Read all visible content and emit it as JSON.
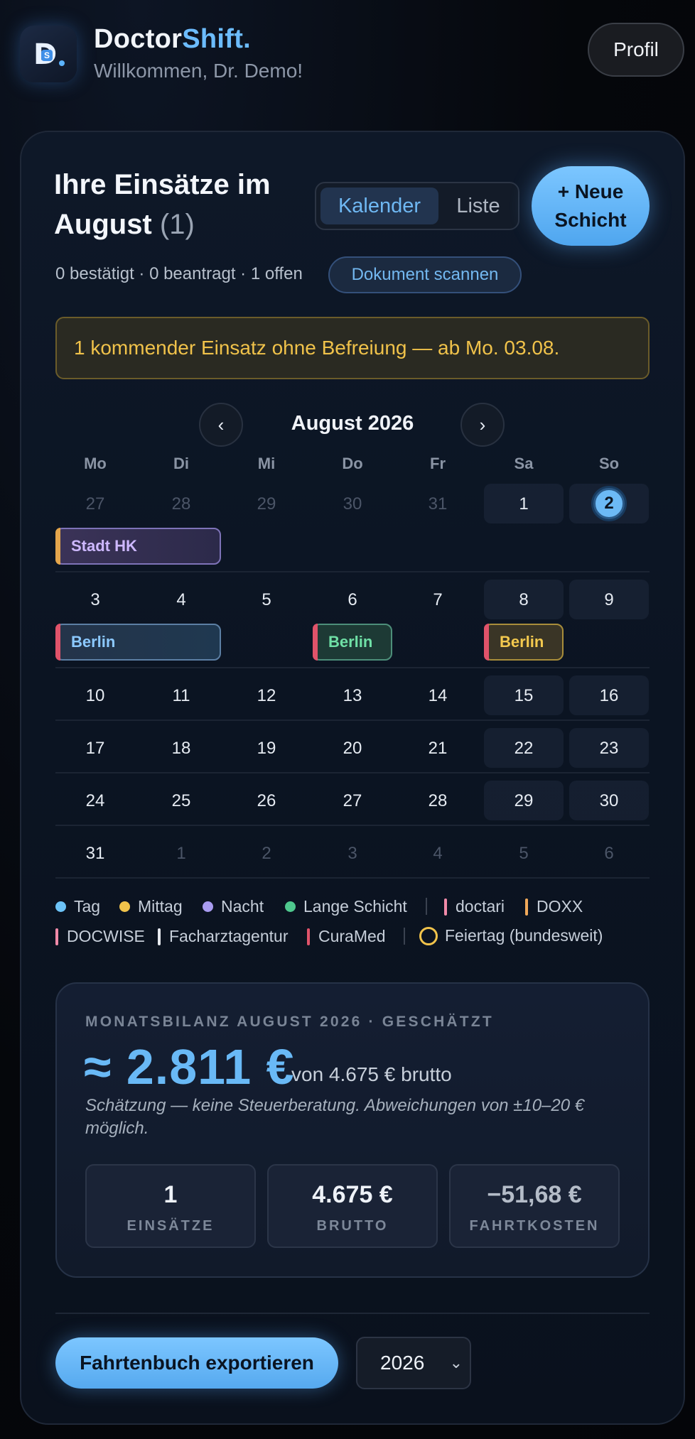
{
  "header": {
    "brand_part1": "Doctor",
    "brand_part2": "Shift.",
    "welcome": "Willkommen, Dr. Demo!",
    "profile_label": "Profil",
    "logo_letter": "D",
    "logo_inner": "S"
  },
  "overview": {
    "title": "Ihre Einsätze im August",
    "count": "(1)",
    "view_calendar": "Kalender",
    "view_list": "Liste",
    "new_shift": "+ Neue\nSchicht",
    "stats": "0 bestätigt · 0 beantragt · 1 offen",
    "scan_label": "Dokument scannen",
    "alert": "1 kommender Einsatz ohne Befreiung — ab Mo. 03.08."
  },
  "calendar": {
    "month_label": "August 2026",
    "prev_icon": "‹",
    "next_icon": "›",
    "weekdays": [
      "Mo",
      "Di",
      "Mi",
      "Do",
      "Fr",
      "Sa",
      "So"
    ],
    "weeks": [
      [
        "27",
        "28",
        "29",
        "30",
        "31",
        "1",
        "2"
      ],
      [
        "3",
        "4",
        "5",
        "6",
        "7",
        "8",
        "9"
      ],
      [
        "10",
        "11",
        "12",
        "13",
        "14",
        "15",
        "16"
      ],
      [
        "17",
        "18",
        "19",
        "20",
        "21",
        "22",
        "23"
      ],
      [
        "24",
        "25",
        "26",
        "27",
        "28",
        "29",
        "30"
      ],
      [
        "31",
        "1",
        "2",
        "3",
        "4",
        "5",
        "6"
      ]
    ],
    "today": "2",
    "events": [
      {
        "label": "Stadt HK",
        "type": "Nacht",
        "color": "#cdb8ff"
      },
      {
        "label": "Berlin",
        "type": "Tag",
        "color": "#8cc9ff"
      },
      {
        "label": "Berlin",
        "type": "Lange Schicht",
        "color": "#6fe0a6"
      },
      {
        "label": "Berlin",
        "type": "Mittag",
        "color": "#f3c94e"
      }
    ]
  },
  "legend": {
    "shift_types": [
      {
        "label": "Tag",
        "color": "#6cc3f7"
      },
      {
        "label": "Mittag",
        "color": "#f1c34b"
      },
      {
        "label": "Nacht",
        "color": "#a99cf0"
      },
      {
        "label": "Lange Schicht",
        "color": "#4fc88e"
      }
    ],
    "agencies": [
      {
        "label": "doctari",
        "color": "#f08aa8"
      },
      {
        "label": "DOXX",
        "color": "#f0a95a"
      },
      {
        "label": "DOCWISE",
        "color": "#f08aa8"
      },
      {
        "label": "Facharztagentur",
        "color": "#e6e9ee"
      },
      {
        "label": "CuraMed",
        "color": "#e0536a"
      }
    ],
    "holiday_label": "Feiertag (bundesweit)"
  },
  "balance": {
    "label": "MONATSBILANZ AUGUST 2026 · GESCHÄTZT",
    "amount": "≈ 2.811 €",
    "brutto_text": "von 4.675 € brutto",
    "note": "Schätzung — keine Steuerberatung. Abweichungen von ±10–20 € möglich.",
    "stats": [
      {
        "value": "1",
        "label": "EINSÄTZE"
      },
      {
        "value": "4.675 €",
        "label": "BRUTTO"
      },
      {
        "value": "−51,68 €",
        "label": "FAHRTKOSTEN"
      }
    ]
  },
  "footer": {
    "export_label": "Fahrtenbuch exportieren",
    "year": "2026"
  }
}
